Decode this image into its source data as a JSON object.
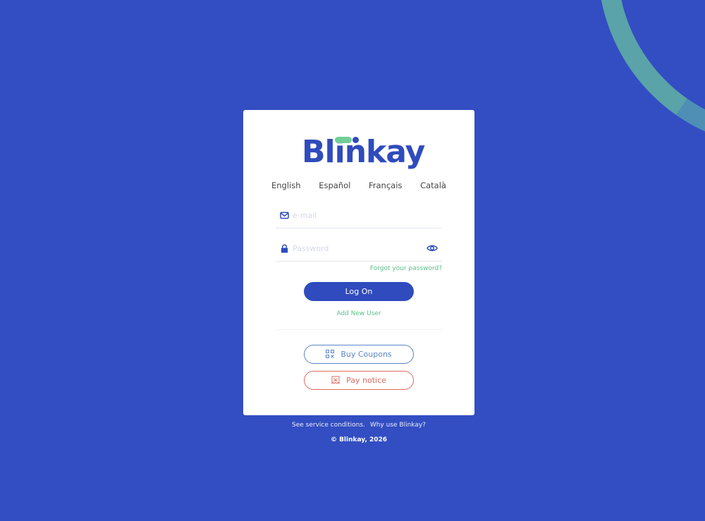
{
  "brand": {
    "logo_text": "Blinkay",
    "primary_color": "#2f4bbd",
    "accent_color": "#6fcf97",
    "background_color": "#334ec2"
  },
  "languages": [
    "English",
    "Español",
    "Français",
    "Català"
  ],
  "form": {
    "email_placeholder": "e-mail",
    "email_icon": "envelope-icon",
    "password_placeholder": "Password",
    "password_icon": "lock-icon",
    "show_password_icon": "eye-icon",
    "forgot_password": "Forgot your password?",
    "login_button": "Log On",
    "add_user": "Add New User"
  },
  "actions": {
    "buy_coupons": "Buy Coupons",
    "buy_coupons_icon": "qr-code-icon",
    "buy_coupons_color": "#5a86c8",
    "pay_notice": "Pay notice",
    "pay_notice_icon": "ticket-icon",
    "pay_notice_color": "#e06a5f"
  },
  "footer": {
    "service_conditions": "See service conditions.",
    "why_use": "Why use Blinkay?",
    "copyright": "© Blinkay, 2026"
  }
}
